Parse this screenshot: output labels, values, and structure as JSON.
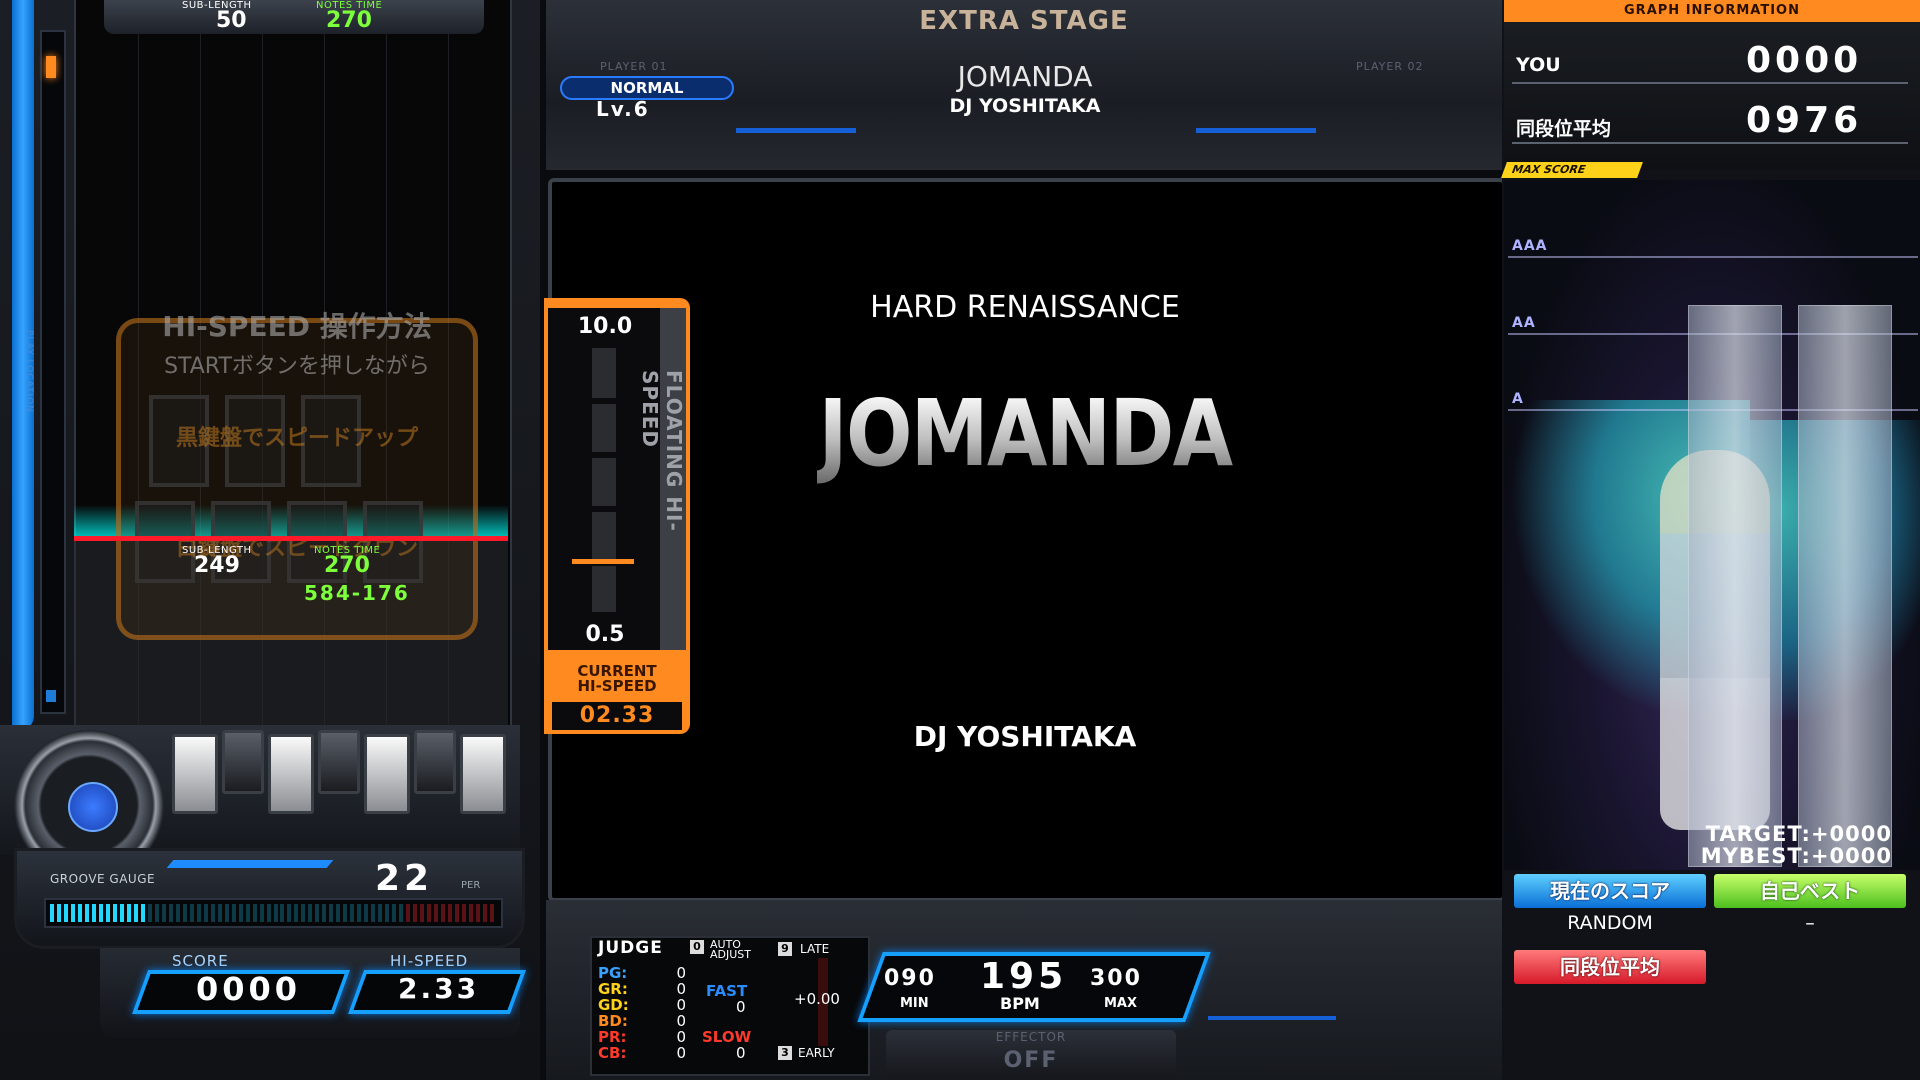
{
  "header": {
    "stage": "EXTRA STAGE",
    "player1_label": "PLAYER 01",
    "player2_label": "PLAYER 02"
  },
  "song": {
    "difficulty": "NORMAL",
    "level": "Lv.6",
    "title": "JOMANDA",
    "artist": "DJ YOSHITAKA",
    "genre": "HARD RENAISSANCE"
  },
  "playfield": {
    "play_location_label": "PLAY LOCATION",
    "top_counter": {
      "sub_length_label": "SUB-LENGTH",
      "sub_length": "50",
      "notes_time_label": "NOTES TIME",
      "notes_time": "270"
    },
    "mid_counter": {
      "sub_length_label": "SUB-LENGTH",
      "sub_length": "249",
      "notes_time_label": "NOTES TIME",
      "notes_time": "270",
      "range": "584-176"
    },
    "hispeed_help": {
      "title": "HI-SPEED 操作方法",
      "line1": "STARTボタンを押しながら",
      "line2": "黒鍵盤でスピードアップ",
      "line3": "白鍵盤でスピードダウン"
    }
  },
  "groove_gauge": {
    "label": "GROOVE GAUGE",
    "value": "22",
    "unit": "PER",
    "fill_fraction": 0.22
  },
  "score": {
    "label": "SCORE",
    "value": "0000"
  },
  "hispeed": {
    "label": "HI-SPEED",
    "value": "2.33"
  },
  "floating_hispeed": {
    "max": "10.0",
    "min": "0.5",
    "vertical_label": "FLOATING HI-SPEED",
    "current_label_1": "CURRENT",
    "current_label_2": "HI-SPEED",
    "current_value": "02.33",
    "level_fraction": 0.19
  },
  "judge": {
    "title": "JUDGE",
    "auto_adjust_num": "0",
    "auto_adjust_label_1": "AUTO",
    "auto_adjust_label_2": "ADJUST",
    "late_num": "9",
    "late_label": "LATE",
    "early_num": "3",
    "early_label": "EARLY",
    "rows": [
      {
        "label": "PG:",
        "value": "0",
        "color": "#3aa0ff"
      },
      {
        "label": "GR:",
        "value": "0",
        "color": "#ffd21a"
      },
      {
        "label": "GD:",
        "value": "0",
        "color": "#ffd21a"
      },
      {
        "label": "BD:",
        "value": "0",
        "color": "#ff8a1f"
      },
      {
        "label": "PR:",
        "value": "0",
        "color": "#ff3a2a"
      },
      {
        "label": "CB:",
        "value": "0",
        "color": "#ff3a2a"
      }
    ],
    "fast_label": "FAST",
    "fast_value": "0",
    "slow_label": "SLOW",
    "slow_value": "0",
    "adjust_value": "+0.00"
  },
  "bpm": {
    "min": "090",
    "current": "195",
    "max": "300",
    "min_label": "MIN",
    "bpm_label": "BPM",
    "max_label": "MAX"
  },
  "effector": {
    "label": "EFFECTOR",
    "value": "OFF"
  },
  "graph": {
    "header": "GRAPH INFORMATION",
    "you_label": "YOU",
    "you_value": "0000",
    "avg_label": "同段位平均",
    "avg_value": "0976",
    "max_score_tag": "MAX SCORE",
    "grades": [
      "AAA",
      "AA",
      "A"
    ],
    "target_text": "TARGET:+0000",
    "mybest_text": "MYBEST:+0000",
    "btn_current": "現在のスコア",
    "btn_best": "自己ベスト",
    "btn_avg": "同段位平均",
    "opt_current": "RANDOM",
    "opt_best": "–"
  },
  "colors": {
    "accent_orange": "#ff8a1f",
    "accent_blue": "#15a0ff",
    "judge_red": "#ff1a2a"
  }
}
